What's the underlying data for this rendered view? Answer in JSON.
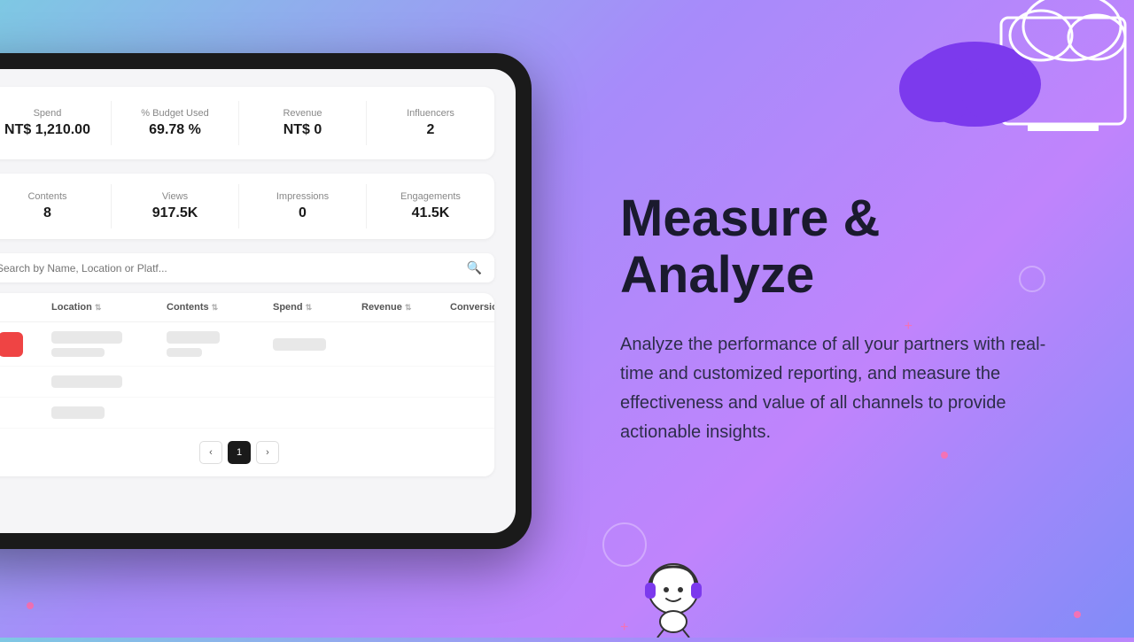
{
  "background": {
    "gradient_start": "#7ec8e3",
    "gradient_mid": "#a78bfa",
    "gradient_end": "#818cf8"
  },
  "dashboard": {
    "stats_row1": [
      {
        "label": "Spend",
        "value": "NT$ 1,210.00"
      },
      {
        "label": "% Budget Used",
        "value": "69.78 %"
      },
      {
        "label": "Revenue",
        "value": "NT$ 0"
      },
      {
        "label": "Influencers",
        "value": "2"
      }
    ],
    "stats_row2": [
      {
        "label": "Contents",
        "value": "8"
      },
      {
        "label": "Views",
        "value": "917.5K"
      },
      {
        "label": "Impressions",
        "value": "0"
      },
      {
        "label": "Engagements",
        "value": "41.5K"
      }
    ],
    "search_placeholder": "Search by Name, Location or Platf...",
    "table_headers": [
      {
        "label": "",
        "sortable": false
      },
      {
        "label": "Location",
        "sortable": true
      },
      {
        "label": "Contents",
        "sortable": true
      },
      {
        "label": "Spend",
        "sortable": true
      },
      {
        "label": "Revenue",
        "sortable": true
      },
      {
        "label": "Conversion",
        "sortable": true
      }
    ],
    "pagination": {
      "current_page": 1,
      "prev_label": "‹",
      "next_label": "›"
    }
  },
  "right_panel": {
    "title": "Measure & Analyze",
    "description": "Analyze the performance of all your partners with real-time and customized reporting, and measure the effectiveness and value of all channels to provide actionable insights."
  }
}
